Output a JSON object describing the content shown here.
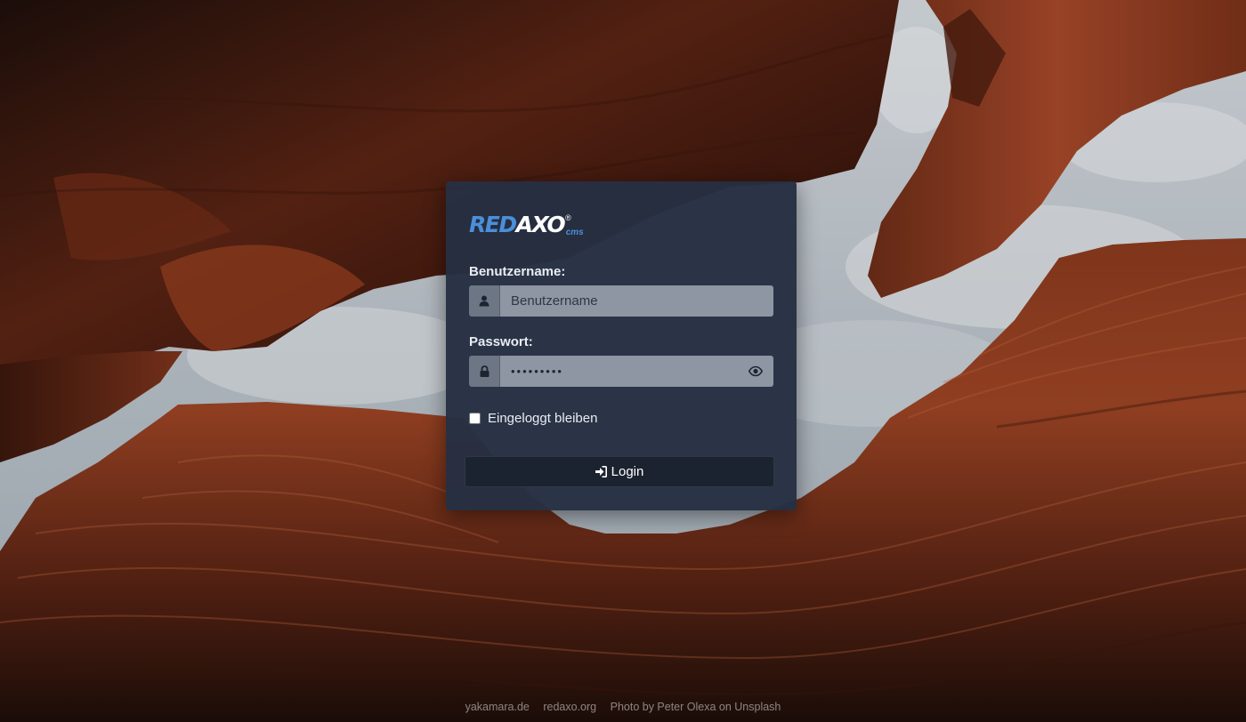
{
  "logo": {
    "part1": "RED",
    "part2": "AXO",
    "registered": "®",
    "suffix": "cms"
  },
  "form": {
    "username_label": "Benutzername:",
    "username_placeholder": "Benutzername",
    "username_value": "",
    "password_label": "Passwort:",
    "password_value_masked": "•••••••••",
    "remember_label": "Eingeloggt bleiben",
    "remember_checked": false,
    "login_label": "Login"
  },
  "icons": {
    "username": "user-icon",
    "password": "lock-icon",
    "toggle_password": "eye-icon",
    "login": "sign-in-icon"
  },
  "footer": {
    "links": [
      "yakamara.de",
      "redaxo.org",
      "Photo by Peter Olexa on Unsplash"
    ]
  },
  "colors": {
    "panel_bg": "#263042",
    "logo_blue": "#4a8fd9",
    "input_bg": "#8e96a3",
    "addon_bg": "#6d7685",
    "button_bg": "#1b2330"
  }
}
